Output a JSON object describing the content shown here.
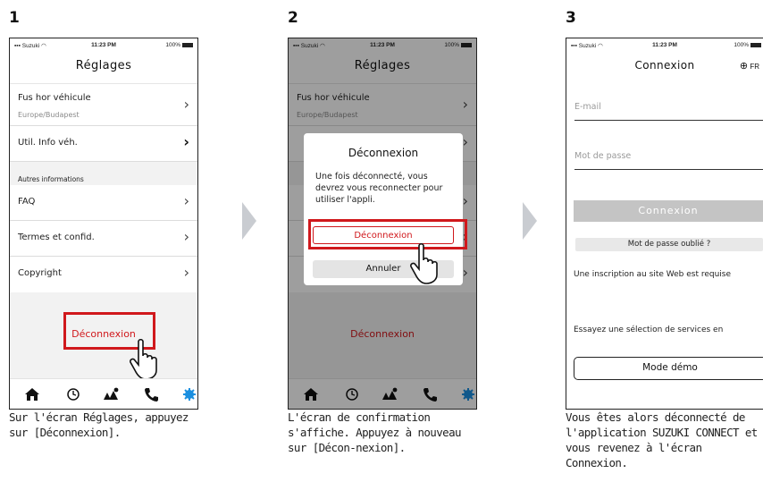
{
  "steps": [
    {
      "number": "1",
      "caption": "Sur l'écran Réglages, appuyez sur [Déconnexion]."
    },
    {
      "number": "2",
      "caption": "L'écran de confirmation s'affiche. Appuyez à nouveau sur [Décon-nexion]."
    },
    {
      "number": "3",
      "caption": "Vous êtes alors déconnecté de l'application SUZUKI CONNECT et vous revenez à l'écran Connexion."
    }
  ],
  "statusbar": {
    "carrier": "Suzuki",
    "time": "11:23 PM",
    "battery": "100%"
  },
  "settings": {
    "title": "Réglages",
    "timezone_label": "Fus hor véhicule",
    "timezone_value": "Europe/Budapest",
    "vehicle_info": "Util. Info véh.",
    "other_section": "Autres informations",
    "faq": "FAQ",
    "terms": "Termes et confid.",
    "copyright": "Copyright",
    "logout": "Déconnexion"
  },
  "dialog": {
    "title": "Déconnexion",
    "message": "Une fois déconnecté, vous devrez vous reconnecter pour utiliser l'appli.",
    "confirm": "Déconnexion",
    "cancel": "Annuler"
  },
  "login": {
    "title": "Connexion",
    "language": "FR",
    "email_placeholder": "E-mail",
    "password_placeholder": "Mot de passe",
    "login_button": "Connexion",
    "forgot_password": "Mot de passe oublié ?",
    "registration_note": "Une inscription au site Web est requise",
    "trial_note": "Essayez une sélection de services en",
    "demo_button": "Mode démo"
  },
  "colors": {
    "accent_red": "#d0181c",
    "active_tab": "#1a8fe0",
    "overlay": "rgba(0,0,0,0.38)"
  },
  "icons": [
    "home-icon",
    "history-icon",
    "map-icon",
    "phone-icon",
    "settings-gear-icon",
    "globe-icon",
    "chevron-right-icon",
    "tap-hand-icon",
    "signal-icon",
    "wifi-icon",
    "battery-icon"
  ]
}
